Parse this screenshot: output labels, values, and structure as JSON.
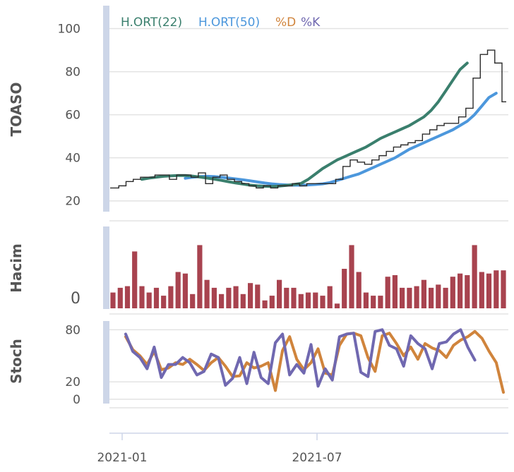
{
  "colors": {
    "price": "#2b2b2b",
    "ma22": "#3a7f6d",
    "ma50": "#4c97dc",
    "pctD": "#d0843c",
    "pctK": "#7068b0",
    "volume": "#a8434f",
    "grid": "#e3e3e3",
    "band": "#cdd6e8"
  },
  "chart_data": [
    {
      "type": "line",
      "panel": "price",
      "ylabel": "TOASO",
      "ylim": [
        15,
        110
      ],
      "yticks": [
        "20",
        "40",
        "60",
        "80",
        "100"
      ],
      "grid": true,
      "legend": {
        "placement": "top-left",
        "entries": [
          {
            "label": "H.ORT(22)",
            "color": "#3a7f6d"
          },
          {
            "label": "H.ORT(50)",
            "color": "#4c97dc"
          },
          {
            "label": "%D",
            "color": "#d0843c"
          },
          {
            "label": "%K",
            "color": "#7068b0"
          }
        ]
      },
      "x": [
        "2020-12-11",
        "2020-12-18",
        "2020-12-25",
        "2021-01-01",
        "2021-01-08",
        "2021-01-15",
        "2021-01-22",
        "2021-01-29",
        "2021-02-05",
        "2021-02-12",
        "2021-02-19",
        "2021-02-26",
        "2021-03-05",
        "2021-03-12",
        "2021-03-19",
        "2021-03-26",
        "2021-04-02",
        "2021-04-09",
        "2021-04-16",
        "2021-04-23",
        "2021-04-30",
        "2021-05-07",
        "2021-05-14",
        "2021-05-21",
        "2021-05-28",
        "2021-06-04",
        "2021-06-11",
        "2021-06-18",
        "2021-06-25",
        "2021-07-02",
        "2021-07-09",
        "2021-07-16",
        "2021-07-23",
        "2021-07-30",
        "2021-08-06",
        "2021-08-13",
        "2021-08-20",
        "2021-08-27",
        "2021-09-03",
        "2021-09-10",
        "2021-09-17",
        "2021-09-24",
        "2021-10-01",
        "2021-10-08",
        "2021-10-15",
        "2021-10-22",
        "2021-10-29",
        "2021-11-05",
        "2021-11-12",
        "2021-11-19",
        "2021-11-26",
        "2021-12-03",
        "2021-12-10",
        "2021-12-17",
        "2021-12-24"
      ],
      "series": [
        {
          "name": "price",
          "close": [
            26,
            27,
            29,
            30,
            31,
            31,
            32,
            32,
            30,
            32,
            32,
            31,
            33,
            28,
            31,
            32,
            30,
            29,
            28,
            27,
            26,
            27,
            26,
            27,
            27,
            28,
            27,
            28,
            28,
            28,
            28,
            30,
            36,
            39,
            38,
            37,
            39,
            41,
            43,
            45,
            46,
            47,
            48,
            51,
            53,
            55,
            56,
            56,
            59,
            63,
            77,
            88,
            90,
            84,
            66
          ]
        },
        {
          "name": "H.ORT(22)",
          "color": "#3a7f6d",
          "values": [
            null,
            null,
            null,
            null,
            30,
            30.6,
            31,
            31.4,
            31.6,
            31.8,
            31.8,
            31.5,
            31.1,
            30.6,
            30.1,
            29.5,
            28.9,
            28.3,
            27.8,
            27.3,
            27,
            26.8,
            26.7,
            26.9,
            27.2,
            27.6,
            28.1,
            30,
            32.5,
            35,
            37,
            39,
            40.5,
            42,
            43.5,
            45,
            47,
            49,
            50.5,
            52,
            53.5,
            55,
            57,
            59,
            62,
            66,
            71,
            76,
            81,
            84
          ]
        },
        {
          "name": "H.ORT(50)",
          "color": "#4c97dc",
          "values": [
            null,
            null,
            null,
            null,
            null,
            null,
            null,
            null,
            null,
            null,
            30.5,
            31,
            31.3,
            31.4,
            31.3,
            31,
            30.6,
            30.2,
            29.8,
            29.3,
            28.8,
            28.3,
            27.9,
            27.6,
            27.4,
            27.3,
            27.3,
            27.4,
            27.6,
            27.9,
            28.5,
            29.5,
            30.5,
            31.5,
            32.5,
            34,
            35.5,
            37,
            38.5,
            40,
            42,
            44,
            45.5,
            47,
            48.5,
            50,
            51.5,
            53,
            55,
            57,
            60,
            64,
            68,
            70
          ]
        }
      ]
    },
    {
      "type": "bar",
      "panel": "volume",
      "ylabel": "Hacim",
      "yticks": [
        "0"
      ],
      "values": [
        20,
        26,
        28,
        72,
        28,
        20,
        26,
        16,
        28,
        46,
        44,
        18,
        80,
        36,
        26,
        18,
        26,
        28,
        18,
        32,
        30,
        10,
        16,
        36,
        26,
        26,
        18,
        20,
        20,
        16,
        28,
        6,
        50,
        80,
        46,
        20,
        16,
        16,
        40,
        42,
        26,
        26,
        28,
        36,
        26,
        30,
        26,
        40,
        44,
        42,
        80,
        46,
        44,
        48,
        48
      ]
    },
    {
      "type": "line",
      "panel": "stochastic",
      "ylabel": "Stoch",
      "ylim": [
        -5,
        90
      ],
      "yticks": [
        "0",
        "20",
        "80"
      ],
      "series": [
        {
          "name": "%D",
          "color": "#d0843c",
          "values": [
            72,
            57,
            50,
            40,
            55,
            34,
            36,
            42,
            40,
            46,
            40,
            33,
            42,
            48,
            38,
            26,
            27,
            42,
            36,
            38,
            42,
            10,
            56,
            72,
            46,
            34,
            42,
            58,
            30,
            28,
            62,
            75,
            76,
            73,
            48,
            32,
            73,
            76,
            64,
            50,
            60,
            46,
            64,
            59,
            56,
            48,
            62,
            68,
            72,
            78,
            70,
            55,
            42,
            8
          ]
        },
        {
          "name": "%K",
          "color": "#7068b0",
          "values": [
            75,
            55,
            48,
            35,
            60,
            25,
            40,
            40,
            48,
            42,
            28,
            32,
            52,
            48,
            16,
            24,
            48,
            18,
            54,
            25,
            18,
            65,
            75,
            28,
            40,
            30,
            63,
            15,
            35,
            22,
            72,
            75,
            76,
            31,
            26,
            78,
            80,
            62,
            58,
            38,
            73,
            64,
            58,
            35,
            64,
            66,
            75,
            80,
            60,
            45,
            5,
            null,
            null,
            null
          ]
        }
      ]
    },
    {
      "type": "axis",
      "panel": "time-axis",
      "xticks": [
        "2021-01",
        "2021-07"
      ]
    }
  ]
}
